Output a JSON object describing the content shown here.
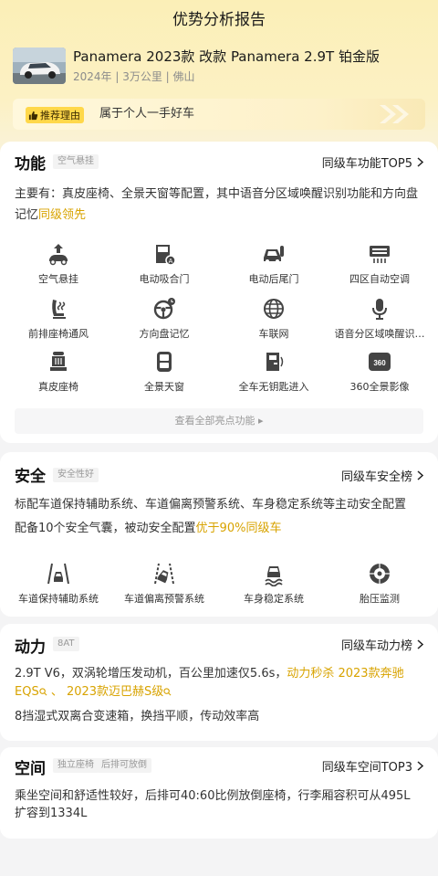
{
  "page": {
    "title": "优势分析报告"
  },
  "car": {
    "name": "Panamera 2023款 改款 Panamera 2.9T 铂金版",
    "meta": "2024年 | 3万公里 | 佛山"
  },
  "recommend": {
    "tag": "推荐理由",
    "text": "属于个人一手好车"
  },
  "function": {
    "title": "功能",
    "chip": "空气悬挂",
    "link": "同级车功能TOP5",
    "desc_prefix": "主要有：真皮座椅、全景天窗等配置，其中语音分区域唤醒识别功能和方向盘记忆",
    "desc_highlight": "同级领先",
    "items": [
      {
        "label": "空气悬挂",
        "icon": "air-suspension-icon"
      },
      {
        "label": "电动吸合门",
        "icon": "power-door-icon"
      },
      {
        "label": "电动后尾门",
        "icon": "power-tailgate-icon"
      },
      {
        "label": "四区自动空调",
        "icon": "climate-control-icon"
      },
      {
        "label": "前排座椅通风",
        "icon": "seat-ventilation-icon"
      },
      {
        "label": "方向盘记忆",
        "icon": "steering-memory-icon"
      },
      {
        "label": "车联网",
        "icon": "connected-car-icon"
      },
      {
        "label": "语音分区域唤醒识…",
        "icon": "microphone-icon"
      },
      {
        "label": "真皮座椅",
        "icon": "leather-seat-icon"
      },
      {
        "label": "全景天窗",
        "icon": "sunroof-icon"
      },
      {
        "label": "全车无钥匙进入",
        "icon": "keyless-entry-icon"
      },
      {
        "label": "360全景影像",
        "icon": "camera-360-icon"
      }
    ],
    "view_all": "查看全部亮点功能 ▸"
  },
  "safety": {
    "title": "安全",
    "chip": "安全性好",
    "link": "同级车安全榜",
    "desc_line1": "标配车道保持辅助系统、车道偏离预警系统、车身稳定系统等主动安全配置",
    "desc_line2_prefix": "配备10个安全气囊，被动安全配置",
    "desc_line2_highlight": "优于90%同级车",
    "items": [
      {
        "label": "车道保持辅助系统",
        "icon": "lane-keeping-icon"
      },
      {
        "label": "车道偏离预警系统",
        "icon": "lane-departure-icon"
      },
      {
        "label": "车身稳定系统",
        "icon": "stability-control-icon"
      },
      {
        "label": "胎压监测",
        "icon": "tire-pressure-icon"
      }
    ]
  },
  "power": {
    "title": "动力",
    "chip": "8AT",
    "link": "同级车动力榜",
    "desc_line1_prefix": "2.9T V6，双涡轮增压发动机，百公里加速仅5.6s，",
    "desc_line1_highlight": "动力秒杀 2023款奔驰",
    "desc_line2_hl1": "EQS",
    "desc_line2_sep": " 、 ",
    "desc_line2_hl2": "2023款迈巴赫S级",
    "desc_line3": "8挡湿式双离合变速箱，换挡平顺，传动效率高"
  },
  "space": {
    "title": "空间",
    "chips": [
      "独立座椅",
      "后排可放倒"
    ],
    "link": "同级车空间TOP3",
    "desc_line1": "乘坐空间和舒适性较好，后排可40:60比例放倒座椅，行李厢容积可从495L",
    "desc_line2": "扩容到1334L"
  },
  "colors": {
    "accent": "#d8a300",
    "tag_bg": "#ffd84a",
    "header_bg": "#fbefb7"
  }
}
